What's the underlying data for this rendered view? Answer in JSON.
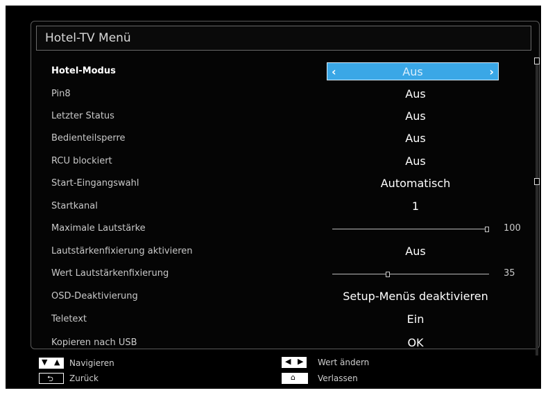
{
  "menu": {
    "title": "Hotel-TV Menü",
    "items": [
      {
        "label": "Hotel-Modus",
        "value": "Aus",
        "selected": true
      },
      {
        "label": "Pin8",
        "value": "Aus"
      },
      {
        "label": "Letzter Status",
        "value": "Aus"
      },
      {
        "label": "Bedienteilsperre",
        "value": "Aus"
      },
      {
        "label": "RCU blockiert",
        "value": "Aus"
      },
      {
        "label": "Start-Eingangswahl",
        "value": "Automatisch"
      },
      {
        "label": "Startkanal",
        "value": "1"
      },
      {
        "label": "Maximale Lautstärke",
        "value": "100",
        "slider_fraction": 1.0
      },
      {
        "label": "Lautstärkenfixierung aktivieren",
        "value": "Aus"
      },
      {
        "label": "Wert Lautstärkenfixierung",
        "value": "35",
        "slider_fraction": 0.35
      },
      {
        "label": "OSD-Deaktivierung",
        "value": "Setup-Menüs deaktivieren"
      },
      {
        "label": "Teletext",
        "value": "Ein"
      },
      {
        "label": "Kopieren nach USB",
        "value": "OK"
      }
    ]
  },
  "footer": {
    "navigate": "Navigieren",
    "back": "Zurück",
    "change_value": "Wert ändern",
    "exit": "Verlassen"
  },
  "icons": {
    "left": "arrow-left-icon",
    "right": "arrow-right-icon",
    "up": "arrow-up-icon",
    "down": "arrow-down-icon",
    "back": "back-icon",
    "home": "home-icon"
  },
  "colors": {
    "highlight": "#3aa7e6",
    "background": "#000000",
    "text": "#ffffff"
  }
}
